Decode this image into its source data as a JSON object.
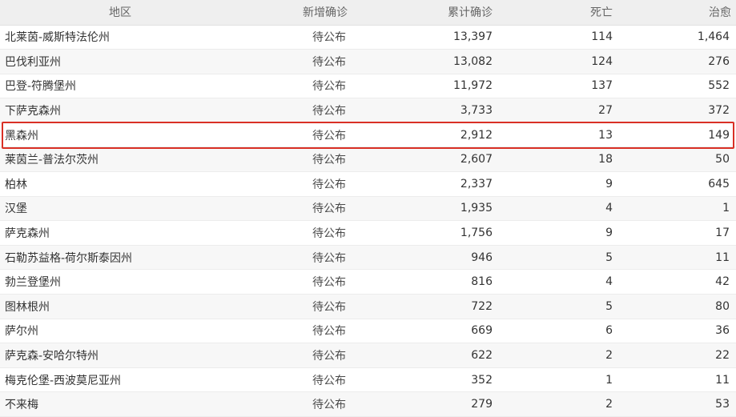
{
  "header": {
    "region": "地区",
    "new_confirmed": "新增确诊",
    "total_confirmed": "累计确诊",
    "deaths": "死亡",
    "recovered": "治愈"
  },
  "rows": [
    {
      "region": "北莱茵-威斯特法伦州",
      "new": "待公布",
      "total": "13,397",
      "deaths": "114",
      "recovered": "1,464"
    },
    {
      "region": "巴伐利亚州",
      "new": "待公布",
      "total": "13,082",
      "deaths": "124",
      "recovered": "276"
    },
    {
      "region": "巴登-符腾堡州",
      "new": "待公布",
      "total": "11,972",
      "deaths": "137",
      "recovered": "552"
    },
    {
      "region": "下萨克森州",
      "new": "待公布",
      "total": "3,733",
      "deaths": "27",
      "recovered": "372"
    },
    {
      "region": "黑森州",
      "new": "待公布",
      "total": "2,912",
      "deaths": "13",
      "recovered": "149"
    },
    {
      "region": "莱茵兰-普法尔茨州",
      "new": "待公布",
      "total": "2,607",
      "deaths": "18",
      "recovered": "50"
    },
    {
      "region": "柏林",
      "new": "待公布",
      "total": "2,337",
      "deaths": "9",
      "recovered": "645"
    },
    {
      "region": "汉堡",
      "new": "待公布",
      "total": "1,935",
      "deaths": "4",
      "recovered": "1"
    },
    {
      "region": "萨克森州",
      "new": "待公布",
      "total": "1,756",
      "deaths": "9",
      "recovered": "17"
    },
    {
      "region": "石勒苏益格-荷尔斯泰因州",
      "new": "待公布",
      "total": "946",
      "deaths": "5",
      "recovered": "11"
    },
    {
      "region": "勃兰登堡州",
      "new": "待公布",
      "total": "816",
      "deaths": "4",
      "recovered": "42"
    },
    {
      "region": "图林根州",
      "new": "待公布",
      "total": "722",
      "deaths": "5",
      "recovered": "80"
    },
    {
      "region": "萨尔州",
      "new": "待公布",
      "total": "669",
      "deaths": "6",
      "recovered": "36"
    },
    {
      "region": "萨克森-安哈尔特州",
      "new": "待公布",
      "total": "622",
      "deaths": "2",
      "recovered": "22"
    },
    {
      "region": "梅克伦堡-西波莫尼亚州",
      "new": "待公布",
      "total": "352",
      "deaths": "1",
      "recovered": "11"
    },
    {
      "region": "不来梅",
      "new": "待公布",
      "total": "279",
      "deaths": "2",
      "recovered": "53"
    }
  ],
  "colors": {
    "header_bg": "#efefef",
    "row_alt_bg": "#f7f7f7",
    "highlight_border": "#d93025"
  }
}
